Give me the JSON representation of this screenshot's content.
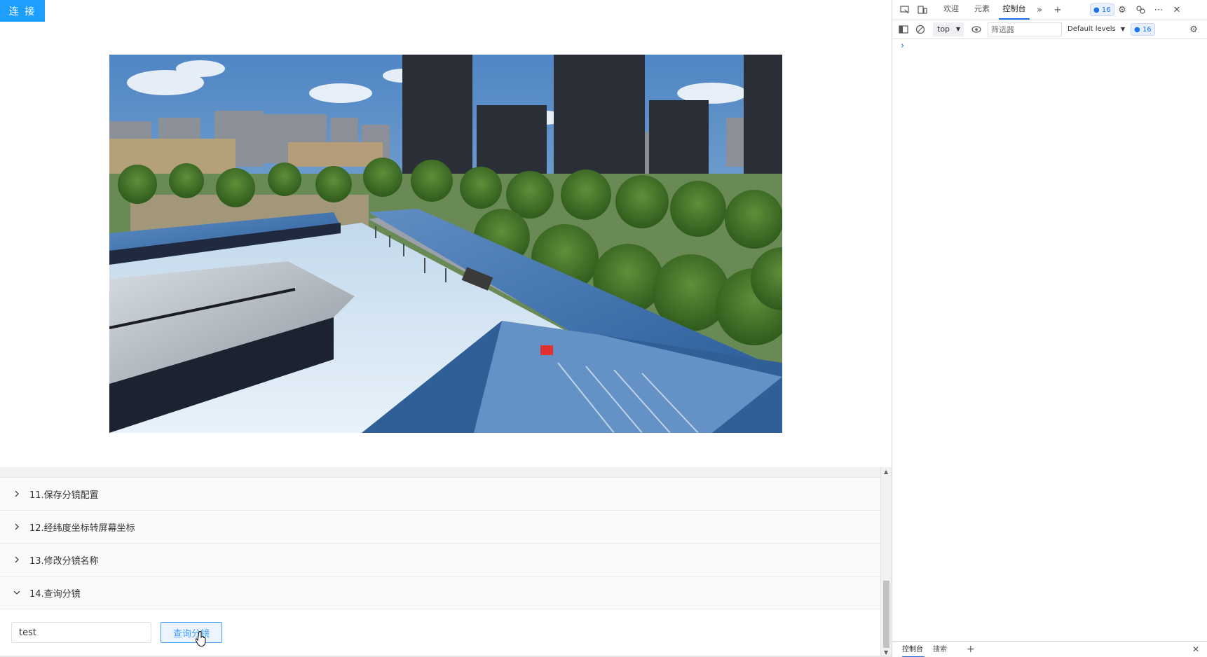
{
  "app": {
    "connect_label": "连 接"
  },
  "collapse": {
    "items": [
      {
        "label": "11.保存分镜配置",
        "expanded": false
      },
      {
        "label": "12.经纬度坐标转屏幕坐标",
        "expanded": false
      },
      {
        "label": "13.修改分镜名称",
        "expanded": false
      },
      {
        "label": "14.查询分镜",
        "expanded": true
      }
    ],
    "query": {
      "input_value": "test",
      "button_label": "查询分镜"
    }
  },
  "devtools": {
    "tabs": [
      "欢迎",
      "元素",
      "控制台"
    ],
    "active_tab": "控制台",
    "issues_count": "16",
    "context": "top",
    "filter_placeholder": "筛选器",
    "levels_label": "Default levels",
    "drawer_tabs": [
      "控制台",
      "搜索"
    ],
    "prompt": "›"
  },
  "colors": {
    "accent": "#1e9fff",
    "link_blue": "#409eff",
    "devtools_active": "#1a73e8"
  }
}
